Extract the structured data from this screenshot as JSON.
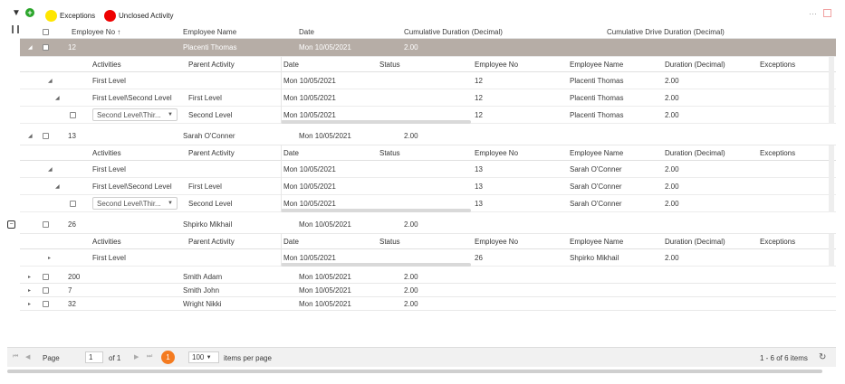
{
  "toolbar": {
    "filter_icon": "funnel-icon",
    "add_icon": "plus-circle-icon",
    "legend": [
      {
        "label": "Exceptions",
        "color": "#ffe600"
      },
      {
        "label": "Unclosed Activity",
        "color": "#ee0000"
      }
    ],
    "more_icon": "ellipsis-icon",
    "export_icon": "export-icon"
  },
  "grid": {
    "columns": [
      "Employee No",
      "Employee Name",
      "Date",
      "Cumulative Duration (Decimal)",
      "Cumulative Drive Duration (Decimal)"
    ],
    "sort_indicator": "↑",
    "detail_columns": [
      "Activities",
      "Parent Activity",
      "Date",
      "Status",
      "Employee No",
      "Employee Name",
      "Duration (Decimal)",
      "Exceptions"
    ],
    "groups": [
      {
        "employee_no": "12",
        "employee_name": "Placenti Thomas",
        "date": "Mon 10/05/2021",
        "duration": "2.00",
        "selected": true,
        "details": [
          {
            "activity": "First Level",
            "parent": "",
            "date": "Mon 10/05/2021",
            "status": "",
            "employee_no": "12",
            "employee_name": "Placenti Thomas",
            "duration": "2.00",
            "exceptions": ""
          },
          {
            "activity": "First Level\\Second Level",
            "parent": "First Level",
            "date": "Mon 10/05/2021",
            "status": "",
            "employee_no": "12",
            "employee_name": "Placenti Thomas",
            "duration": "2.00",
            "exceptions": ""
          },
          {
            "activity": "Second Level\\Thir...",
            "parent": "Second Level",
            "date": "Mon 10/05/2021",
            "status": "",
            "employee_no": "12",
            "employee_name": "Placenti Thomas",
            "duration": "2.00",
            "exceptions": ""
          }
        ]
      },
      {
        "employee_no": "13",
        "employee_name": "Sarah O'Conner",
        "date": "Mon 10/05/2021",
        "duration": "2.00",
        "selected": false,
        "details": [
          {
            "activity": "First Level",
            "parent": "",
            "date": "Mon 10/05/2021",
            "status": "",
            "employee_no": "13",
            "employee_name": "Sarah O'Conner",
            "duration": "2.00",
            "exceptions": ""
          },
          {
            "activity": "First Level\\Second Level",
            "parent": "First Level",
            "date": "Mon 10/05/2021",
            "status": "",
            "employee_no": "13",
            "employee_name": "Sarah O'Conner",
            "duration": "2.00",
            "exceptions": ""
          },
          {
            "activity": "Second Level\\Thir...",
            "parent": "Second Level",
            "date": "Mon 10/05/2021",
            "status": "",
            "employee_no": "13",
            "employee_name": "Sarah O'Conner",
            "duration": "2.00",
            "exceptions": ""
          }
        ]
      },
      {
        "employee_no": "26",
        "employee_name": "Shpirko Mikhail",
        "date": "Mon 10/05/2021",
        "duration": "2.00",
        "selected": false,
        "details": [
          {
            "activity": "First Level",
            "parent": "",
            "date": "Mon 10/05/2021",
            "status": "",
            "employee_no": "26",
            "employee_name": "Shpirko Mikhail",
            "duration": "2.00",
            "exceptions": ""
          }
        ]
      }
    ],
    "collapsed_rows": [
      {
        "employee_no": "200",
        "employee_name": "Smith Adam",
        "date": "Mon 10/05/2021",
        "duration": "2.00"
      },
      {
        "employee_no": "7",
        "employee_name": "Smith John",
        "date": "Mon 10/05/2021",
        "duration": "2.00"
      },
      {
        "employee_no": "32",
        "employee_name": "Wright Nikki",
        "date": "Mon 10/05/2021",
        "duration": "2.00"
      }
    ]
  },
  "pager": {
    "page_label": "Page",
    "page_value": "1",
    "of_label": "of 1",
    "current_page": "1",
    "page_size": "100",
    "items_per_page_label": "items per page",
    "summary": "1 - 6 of 6 items",
    "accent": "#f47b20"
  }
}
